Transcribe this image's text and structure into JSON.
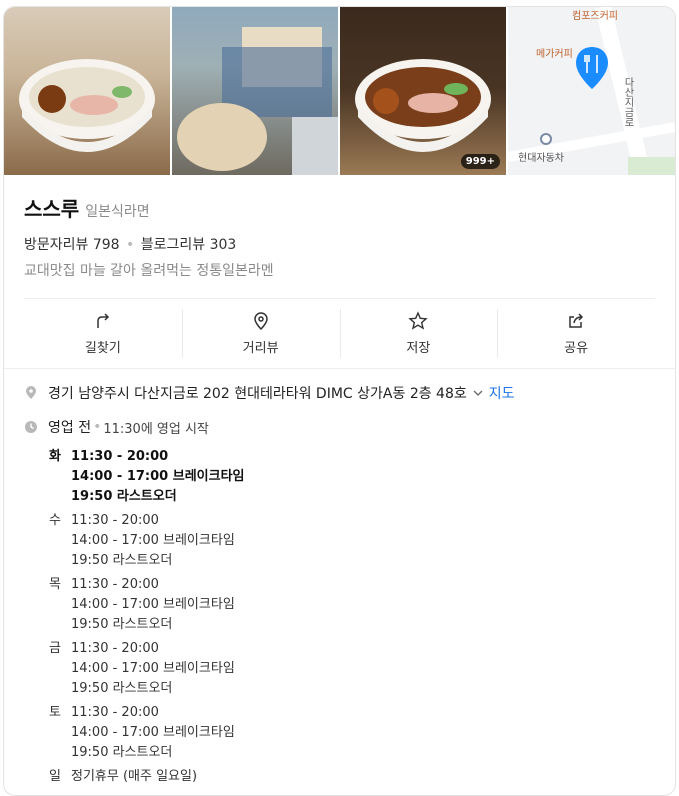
{
  "photos": {
    "photo_count_badge": "999+",
    "map": {
      "labels": [
        "컴포즈커피",
        "메가커피",
        "현대자동차",
        "다산지금로"
      ]
    }
  },
  "place": {
    "name": "스스루",
    "category": "일본식라면",
    "visitor_reviews": "방문자리뷰 798",
    "blog_reviews": "블로그리뷰 303",
    "description": "교대맛집 마늘 갈아 올려먹는 정통일본라멘"
  },
  "actions": [
    {
      "label": "길찾기",
      "icon": "directions-icon"
    },
    {
      "label": "거리뷰",
      "icon": "street-view-icon"
    },
    {
      "label": "저장",
      "icon": "star-icon"
    },
    {
      "label": "공유",
      "icon": "share-icon"
    }
  ],
  "address": {
    "text": "경기 남양주시 다산지금로 202 현대테라타워 DIMC 상가A동 2층 48호",
    "map_link": "지도"
  },
  "status": {
    "label": "영업 전",
    "note": "11:30에 영업 시작"
  },
  "hours": [
    {
      "day": "화",
      "lines": [
        "11:30 - 20:00",
        "14:00 - 17:00 브레이크타임",
        "19:50 라스트오더"
      ]
    },
    {
      "day": "수",
      "lines": [
        "11:30 - 20:00",
        "14:00 - 17:00 브레이크타임",
        "19:50 라스트오더"
      ]
    },
    {
      "day": "목",
      "lines": [
        "11:30 - 20:00",
        "14:00 - 17:00 브레이크타임",
        "19:50 라스트오더"
      ]
    },
    {
      "day": "금",
      "lines": [
        "11:30 - 20:00",
        "14:00 - 17:00 브레이크타임",
        "19:50 라스트오더"
      ]
    },
    {
      "day": "토",
      "lines": [
        "11:30 - 20:00",
        "14:00 - 17:00 브레이크타임",
        "19:50 라스트오더"
      ]
    },
    {
      "day": "일",
      "lines": [
        "정기휴무 (매주 일요일)"
      ]
    }
  ],
  "colors": {
    "link": "#1a73e8",
    "pin": "#1a8cff",
    "muted": "#8a8a8a"
  }
}
